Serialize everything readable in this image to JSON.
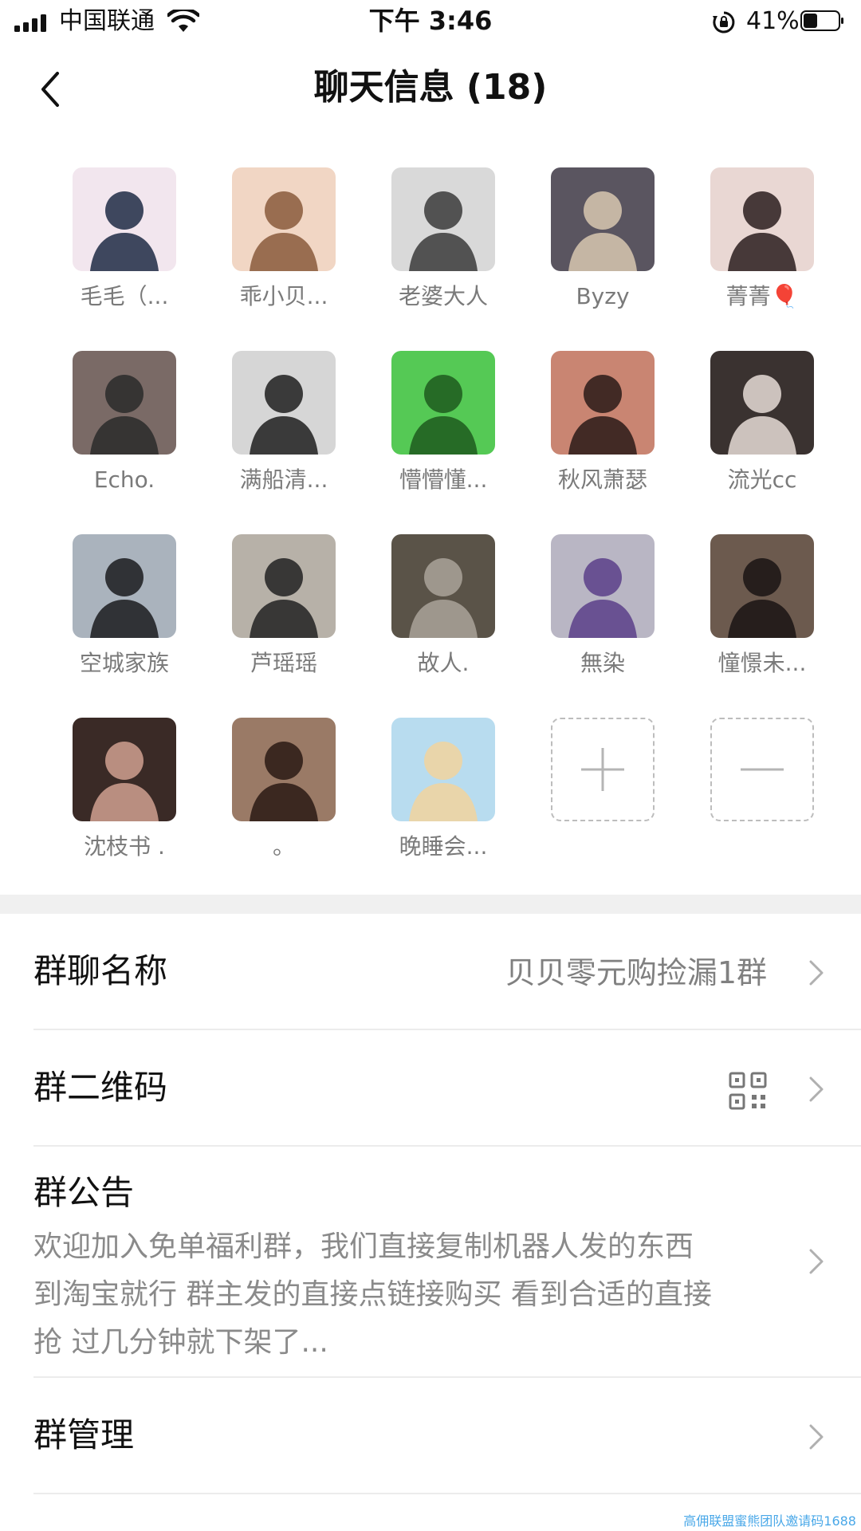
{
  "status_bar": {
    "carrier": "中国联通",
    "time": "下午 3:46",
    "battery_percent": "41%",
    "battery_level": 0.41
  },
  "nav": {
    "title": "聊天信息 (18)",
    "back_icon": "chevron-left-icon"
  },
  "members": [
    {
      "name": "毛毛（...",
      "avatar": {
        "bg": "#f2e6ee",
        "fg": "#1f2a44"
      }
    },
    {
      "name": "乖小贝...",
      "avatar": {
        "bg": "#f1d6c4",
        "fg": "#8a5a3c"
      }
    },
    {
      "name": "老婆大人",
      "avatar": {
        "bg": "#d9d9d9",
        "fg": "#3a3a3a"
      }
    },
    {
      "name": "Byzy",
      "avatar": {
        "bg": "#5a5560",
        "fg": "#d8c8b0"
      }
    },
    {
      "name": "菁菁🎈",
      "avatar": {
        "bg": "#e9d7d3",
        "fg": "#2a1d1d"
      }
    },
    {
      "name": "Echo.",
      "avatar": {
        "bg": "#7a6a66",
        "fg": "#2a2a2a"
      }
    },
    {
      "name": "满船清...",
      "avatar": {
        "bg": "#d6d6d6",
        "fg": "#1e1e1e"
      }
    },
    {
      "name": "懵懵懂...",
      "avatar": {
        "bg": "#55c955",
        "fg": "#1e5a1e"
      }
    },
    {
      "name": "秋风萧瑟",
      "avatar": {
        "bg": "#c98572",
        "fg": "#2a1a18"
      }
    },
    {
      "name": "流光cc",
      "avatar": {
        "bg": "#3a3230",
        "fg": "#e6dcd6"
      }
    },
    {
      "name": "空城家族",
      "avatar": {
        "bg": "#aab3bd",
        "fg": "#1b1b1f"
      }
    },
    {
      "name": "芦瑶瑶",
      "avatar": {
        "bg": "#b7b1a8",
        "fg": "#222222"
      }
    },
    {
      "name": "故人.",
      "avatar": {
        "bg": "#5a5348",
        "fg": "#aaa39a"
      }
    },
    {
      "name": "無染",
      "avatar": {
        "bg": "#b9b6c4",
        "fg": "#5a3f8a"
      }
    },
    {
      "name": "憧憬未...",
      "avatar": {
        "bg": "#6c5a4e",
        "fg": "#1a1414"
      }
    },
    {
      "name": "沈枝书 .",
      "avatar": {
        "bg": "#3a2a26",
        "fg": "#d0a090"
      }
    },
    {
      "name": "。",
      "avatar": {
        "bg": "#9a7a66",
        "fg": "#2a1a14"
      }
    },
    {
      "name": "晚睡会...",
      "avatar": {
        "bg": "#b8dcef",
        "fg": "#f1d39e"
      }
    }
  ],
  "member_actions": {
    "add_icon": "plus-icon",
    "remove_icon": "minus-icon"
  },
  "settings": {
    "group_name_label": "群聊名称",
    "group_name_value": "贝贝零元购捡漏1群",
    "qr_label": "群二维码",
    "qr_icon": "qr-code-icon",
    "notice_label": "群公告",
    "notice_text": "欢迎加入免单福利群，我们直接复制机器人发的东西\n到淘宝就行 群主发的直接点链接购买 看到合适的直接\n抢 过几分钟就下架了...",
    "manage_label": "群管理"
  },
  "watermark": "高佣联盟蜜熊团队邀请码1688",
  "colors": {
    "divider": "#ececec",
    "section_gap": "#f0f0f0",
    "secondary_text": "#808080",
    "watermark": "#4aa8e8"
  }
}
